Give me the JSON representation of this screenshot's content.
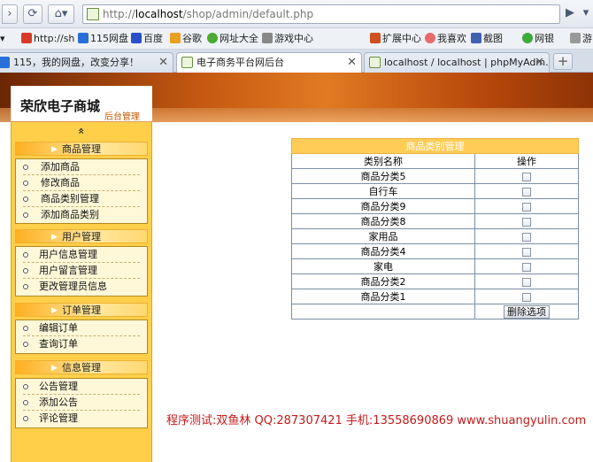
{
  "browser": {
    "url_prefix": "http://",
    "url_host": "localhost",
    "url_path": "/shop/admin/default.php",
    "bookmarks": [
      "http://sh",
      "115网盘",
      "百度",
      "谷歌",
      "网址大全",
      "游戏中心",
      "扩展中心",
      "我喜欢",
      "截图",
      "网银",
      "游"
    ],
    "tabs": [
      "115，我的网盘，改变分享！",
      "电子商务平台网后台",
      "localhost / localhost | phpMyAdm..."
    ],
    "active_tab": 1
  },
  "site": {
    "title": "荣欣电子商城",
    "subtitle": "后台管理"
  },
  "sidebar": {
    "collapse_glyph": "«",
    "groups": [
      {
        "title": "商品管理",
        "items": [
          "添加商品",
          "修改商品",
          "商品类别管理",
          "添加商品类别"
        ]
      },
      {
        "title": "用户管理",
        "items": [
          "用户信息管理",
          "用户留言管理",
          "更改管理员信息"
        ]
      },
      {
        "title": "订单管理",
        "items": [
          "编辑订单",
          "查询订单"
        ]
      },
      {
        "title": "信息管理",
        "items": [
          "公告管理",
          "添加公告",
          "评论管理"
        ]
      }
    ]
  },
  "table": {
    "caption": "商品类别管理",
    "headers": [
      "类别名称",
      "操作"
    ],
    "rows": [
      "商品分类5",
      "自行车",
      "商品分类9",
      "商品分类8",
      "家用品",
      "商品分类4",
      "家电",
      "商品分类2",
      "商品分类1"
    ],
    "delete_label": "删除选项"
  },
  "footer": {
    "text": "程序测试:双鱼林 QQ:287307421 手机:13558690869 www.shuangyulin.com"
  }
}
